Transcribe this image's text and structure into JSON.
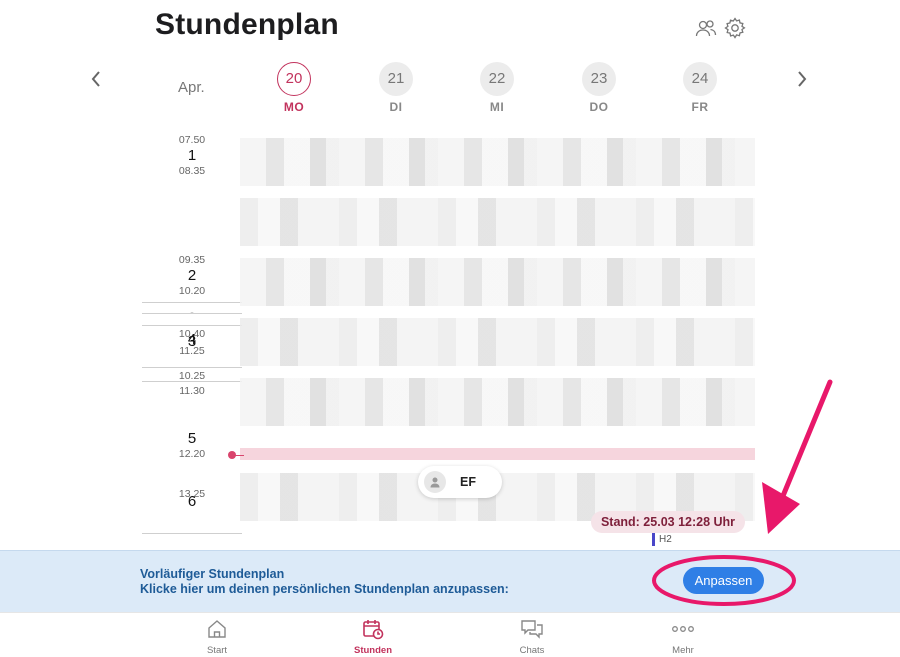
{
  "header": {
    "title": "Stundenplan",
    "icons": [
      "people-icon",
      "gear-icon"
    ]
  },
  "week": {
    "month": "Apr.",
    "days": [
      {
        "num": "20",
        "label": "MO",
        "active": true
      },
      {
        "num": "21",
        "label": "DI",
        "active": false
      },
      {
        "num": "22",
        "label": "MI",
        "active": false
      },
      {
        "num": "23",
        "label": "DO",
        "active": false
      },
      {
        "num": "24",
        "label": "FR",
        "active": false
      }
    ]
  },
  "periods": [
    {
      "start": "07.50",
      "num": "1",
      "end": "08.35"
    },
    {
      "start": "09.35",
      "num": "2",
      "end": "10.20"
    },
    {
      "start": "10.40",
      "num": "3",
      "end": "11.25"
    },
    {
      "start": "",
      "num": "4",
      "end": "10.25"
    },
    {
      "start": "11.30",
      "num": "5",
      "end": "12.20"
    },
    {
      "start": "13.25",
      "num": "6",
      "end": ""
    }
  ],
  "schedule": {
    "dash": "-",
    "ef_label": "EF",
    "stand": "Stand: 25.03 12:28 Uhr",
    "h2_label": "H2"
  },
  "banner": {
    "line1": "Vorläufiger Stundenplan",
    "line2": "Klicke hier um deinen persönlichen Stundenplan anzupassen:",
    "button": "Anpassen"
  },
  "tabbar": [
    {
      "label": "Start",
      "icon": "home-icon",
      "active": false
    },
    {
      "label": "Stunden",
      "icon": "calendar-clock-icon",
      "active": true
    },
    {
      "label": "Chats",
      "icon": "chat-icon",
      "active": false
    },
    {
      "label": "Mehr",
      "icon": "more-icon",
      "active": false
    }
  ],
  "colors": {
    "accent": "#c2335d",
    "banner_bg": "#dceaf8",
    "banner_text": "#1e5b97",
    "button": "#2f7fe6",
    "annotation": "#e8186a"
  }
}
